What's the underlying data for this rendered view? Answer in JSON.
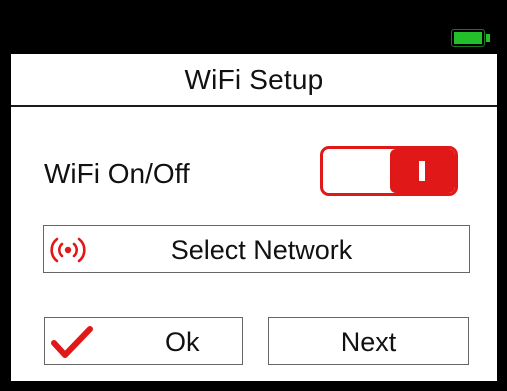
{
  "header": {
    "battery_icon": "battery-full-icon",
    "battery_color": "#22c02a"
  },
  "screen": {
    "title": "WiFi Setup",
    "wifi_toggle": {
      "label": "WiFi On/Off",
      "state": "on",
      "accent_color": "#e01818"
    },
    "select_network": {
      "label": "Select Network",
      "icon": "wifi-broadcast-icon"
    },
    "buttons": {
      "ok_label": "Ok",
      "ok_icon": "checkmark-icon",
      "next_label": "Next"
    }
  }
}
